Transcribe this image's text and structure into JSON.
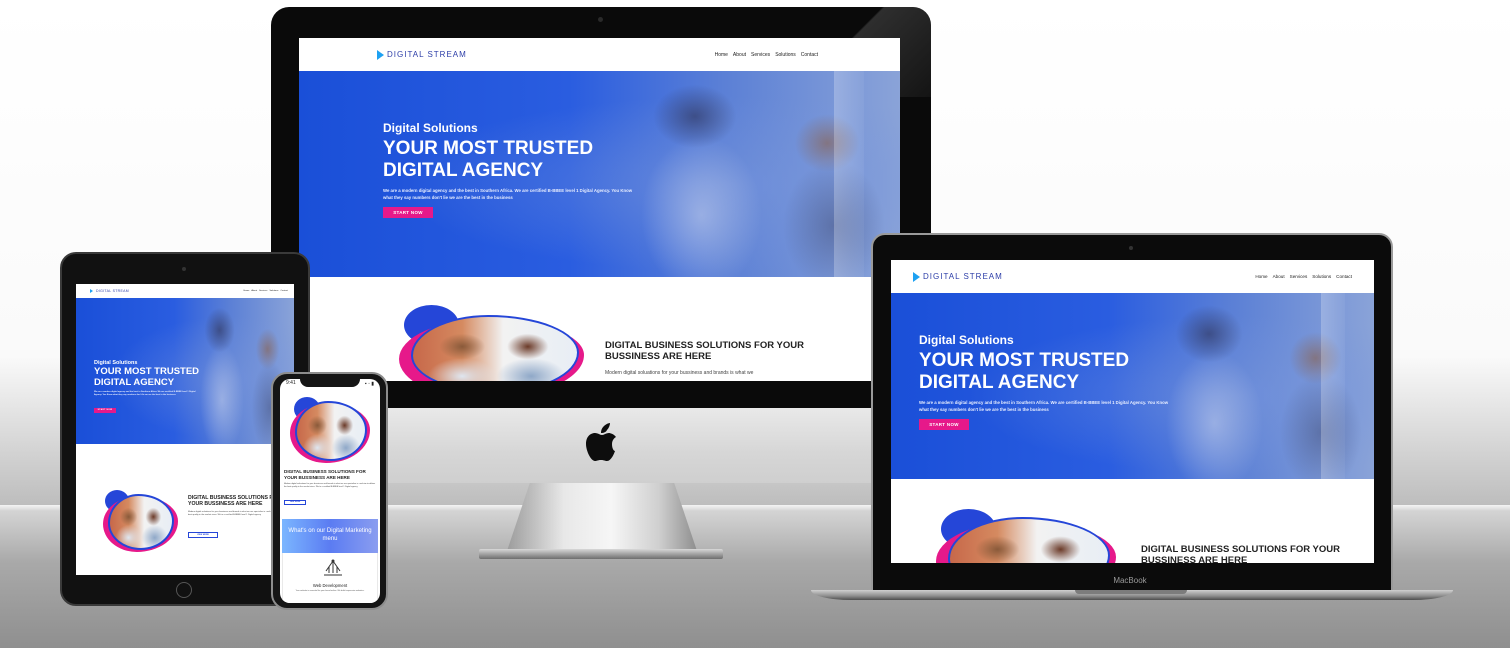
{
  "site": {
    "brand": "DIGITAL STREAM",
    "nav": [
      "Home",
      "About",
      "Services",
      "Solutions",
      "Contact"
    ],
    "hero": {
      "subtitle": "Digital Solutions",
      "title_line1": "YOUR MOST TRUSTED",
      "title_line2": "DIGITAL AGENCY",
      "paragraph": "We are a modern digital agency and the best in Southern Africa. We are certified B-BBEE level 1 Digital Agency. You Know what they say numbers don't lie we are the best in the business",
      "cta": "START NOW"
    },
    "solutions": {
      "title": "DIGITAL BUSINESS SOLUTIONS FOR YOUR BUSSINESS ARE HERE",
      "text": "Modern digital soluations for your bussiness and brands is what we",
      "tablet_text": "Modern digital soluations for your bussiness and brands is what we are specialize in. and aim to deliver the best quality in the market since. We're a certified B-BBEE level 1 Digital agency",
      "read_more": "VIEW MORE"
    },
    "menu_card": "What's on our Digital Marketing menu",
    "service": {
      "title": "Web Development",
      "text": "Your website is essential for your brand online. We build responsive websites."
    }
  },
  "phone": {
    "time": "9:41",
    "status_icons": "▪ ◦ ▮"
  },
  "laptop": {
    "label": "MacBook"
  }
}
